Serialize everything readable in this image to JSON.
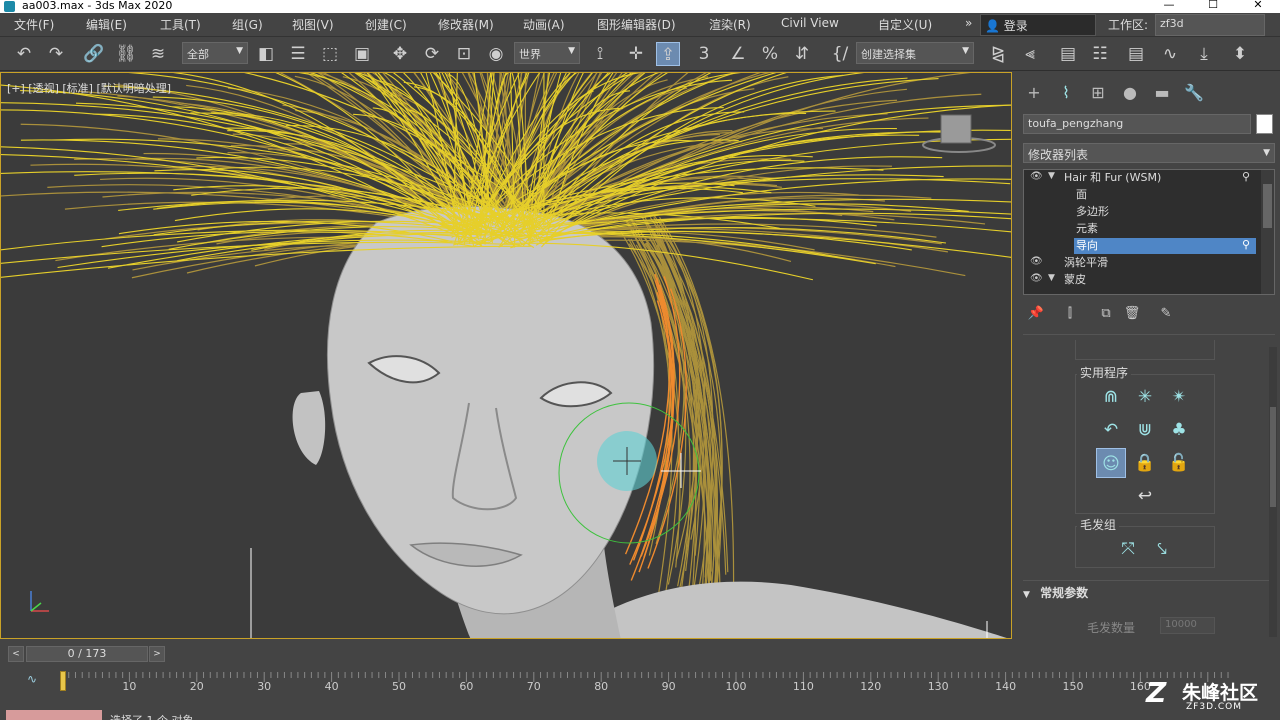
{
  "window": {
    "title": "aa003.max - 3ds Max 2020",
    "min_glyph": "—",
    "max_glyph": "☐",
    "close_glyph": "✕"
  },
  "menu": {
    "items": [
      "文件(F)",
      "编辑(E)",
      "工具(T)",
      "组(G)",
      "视图(V)",
      "创建(C)",
      "修改器(M)",
      "动画(A)",
      "图形编辑器(D)",
      "渲染(R)",
      "Civil View",
      "自定义(U)"
    ],
    "more_glyph": "»",
    "login": "登录",
    "login_icon": "👤",
    "workspace_label": "工作区:",
    "workspace_value": "zf3d"
  },
  "toolbar": {
    "selection_filter": "全部",
    "coord_system": "世界",
    "named_selection": "创建选择集",
    "icons": {
      "undo": "↶",
      "redo": "↷",
      "link": "🔗",
      "unlink": "⛓",
      "bind": "≋",
      "select": "◧",
      "select_by_name": "☰",
      "rect_region": "⬚",
      "window_crossing": "▣",
      "move": "✥",
      "rotate": "⟳",
      "scale": "⊡",
      "select_manip": "◉",
      "pivot": "⟟",
      "snap": "✛",
      "snap_toggle": "⇪",
      "angle_snap": "∠",
      "percent_snap": "%",
      "spinner_snap": "⇵",
      "edit_named": "{/",
      "mirror": "⧎",
      "align": "⫷",
      "layer": "▤",
      "ribbon": "☷",
      "curve_editor": "∿",
      "schematic": "⤓",
      "material": "⬍"
    },
    "snap_label": "3"
  },
  "viewport": {
    "label": "[+] [透视] [标准] [默认明暗处理]"
  },
  "command_panel": {
    "tabs": [
      "+",
      "⌇",
      "⊞",
      "●",
      "▬",
      "🔧"
    ],
    "object_name": "toufa_pengzhang",
    "object_color": "#ffffff",
    "modifier_list": "修改器列表",
    "stack": [
      {
        "label": "Hair 和 Fur (WSM)",
        "eye": true,
        "expand": "▼",
        "wrench": true
      },
      {
        "label": "面",
        "eye": false
      },
      {
        "label": "多边形",
        "eye": false
      },
      {
        "label": "元素",
        "eye": false
      },
      {
        "label": "导向",
        "eye": false,
        "selected": true,
        "wrench": true
      },
      {
        "label": "涡轮平滑",
        "eye": true
      },
      {
        "label": "蒙皮",
        "eye": true,
        "expand": "▼"
      }
    ],
    "stack_tools": [
      "📌",
      "⫿",
      "⧉",
      "🗑",
      "✎"
    ],
    "utilities_title": "实用程序",
    "utilities_icons": [
      "⋒",
      "✳",
      "✴",
      "↶",
      "⋓",
      "♣",
      "☺",
      "🔒",
      "🔓",
      "↩"
    ],
    "hair_group_title": "毛发组",
    "hair_group_icons": [
      "⤧",
      "⤥"
    ],
    "rollout_title": "常规参数",
    "hair_count_label": "毛发数量",
    "hair_count_value": "10000"
  },
  "timeline": {
    "frame_counter": "0 / 173",
    "prev": "<",
    "next": ">",
    "ticks": [
      10,
      20,
      30,
      40,
      50,
      60,
      70,
      80,
      90,
      100,
      110,
      120,
      130,
      140,
      150,
      160
    ]
  },
  "status": {
    "text": "选择了 1 个 对象"
  },
  "watermark": {
    "logo": "Z",
    "name": "朱峰社区",
    "url": "ZF3D.COM"
  },
  "colors": {
    "hair_yellow": "#e6cf2a",
    "hair_dark": "#b79a3c",
    "guide_orange": "#ee8a2e",
    "selection_blue": "#4f86c6",
    "gizmo_cyan": "#5fd0d4",
    "gizmo_green": "#3ec23e"
  }
}
